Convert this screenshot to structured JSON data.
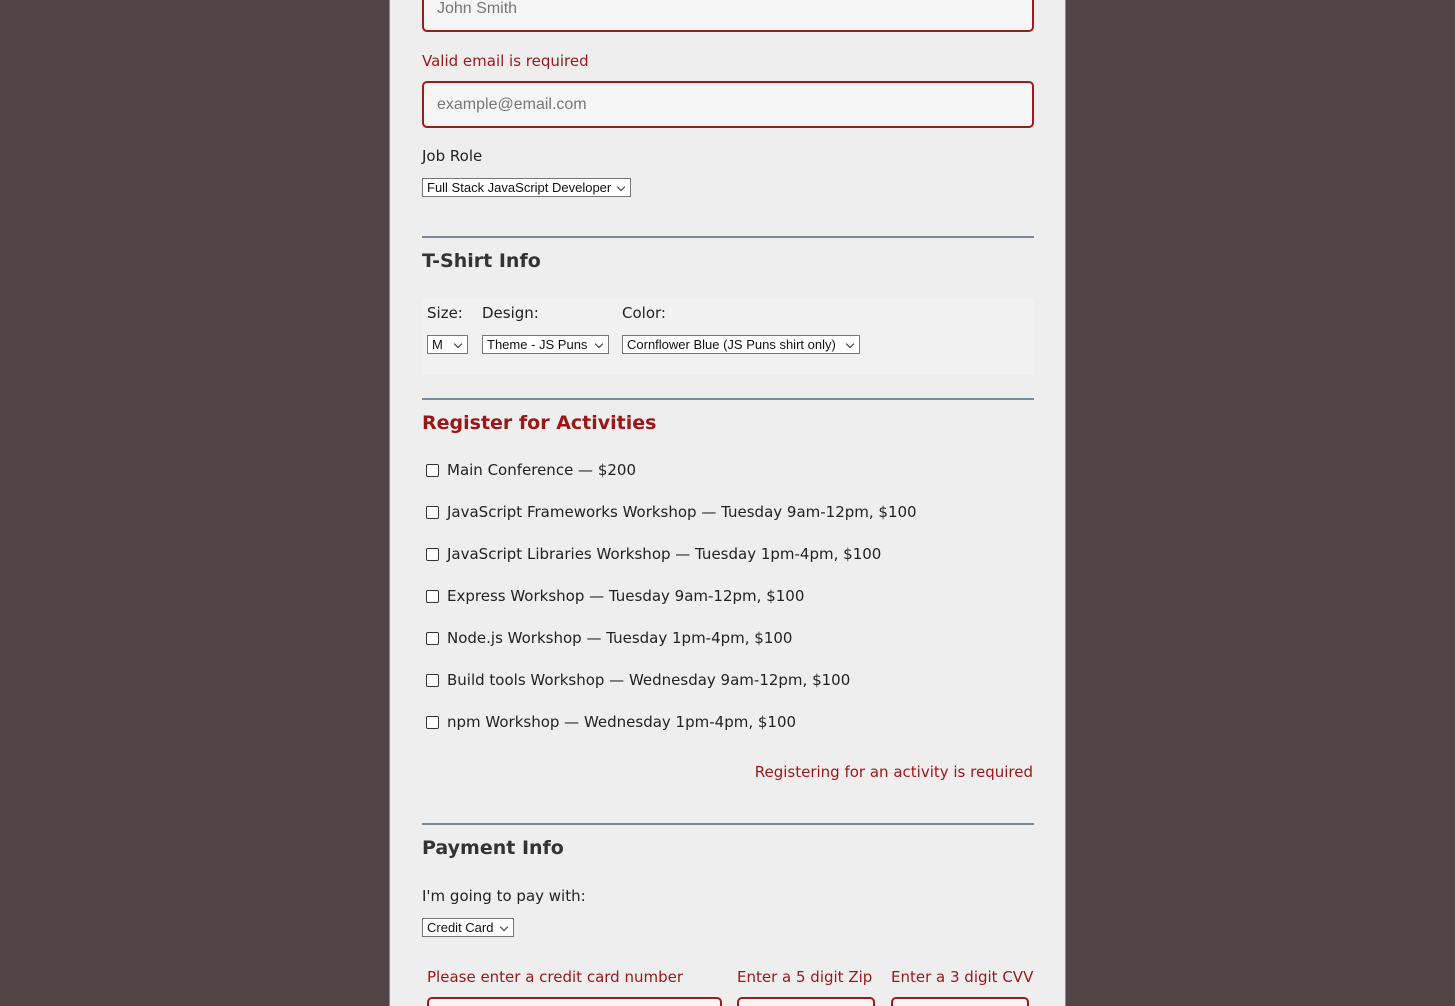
{
  "basic_info": {
    "name_placeholder": "John Smith",
    "email_error": "Valid email is required",
    "email_placeholder": "example@email.com",
    "job_role_label": "Job Role",
    "job_role_value": "Full Stack JavaScript Developer"
  },
  "tshirt": {
    "heading": "T-Shirt Info",
    "size_label": "Size:",
    "size_value": "M",
    "design_label": "Design:",
    "design_value": "Theme - JS Puns",
    "color_label": "Color:",
    "color_value": "Cornflower Blue (JS Puns shirt only)"
  },
  "activities": {
    "heading": "Register for Activities",
    "items": [
      {
        "label": "Main Conference — $200"
      },
      {
        "label": "JavaScript Frameworks Workshop — Tuesday 9am-12pm, $100"
      },
      {
        "label": "JavaScript Libraries Workshop — Tuesday 1pm-4pm, $100"
      },
      {
        "label": "Express Workshop — Tuesday 9am-12pm, $100"
      },
      {
        "label": "Node.js Workshop — Tuesday 1pm-4pm, $100"
      },
      {
        "label": "Build tools Workshop — Wednesday 9am-12pm, $100"
      },
      {
        "label": "npm Workshop — Wednesday 1pm-4pm, $100"
      }
    ],
    "error": "Registering for an activity is required"
  },
  "payment": {
    "heading": "Payment Info",
    "pay_label": "I'm going to pay with:",
    "pay_value": "Credit Card",
    "cc_error": "Please enter a credit card number",
    "zip_error": "Enter a 5 digit Zip",
    "cvv_error": "Enter a 3 digit CVV"
  },
  "colors": {
    "error_red": "#9b1717",
    "background": "#514548",
    "panel": "#eeeeee",
    "rule": "#748b99"
  }
}
